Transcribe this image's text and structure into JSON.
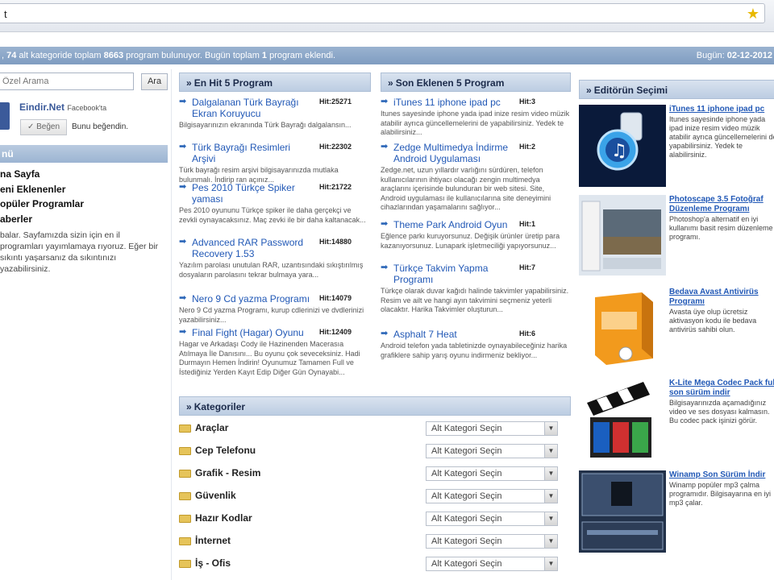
{
  "browser": {
    "url_fragment": "t"
  },
  "infobar": {
    "left_prefix": ", ",
    "cat_count": "74",
    "left_mid": " alt kategoride toplam ",
    "program_count": "8663",
    "left_mid2": " program bulunuyor. Bugün toplam ",
    "today_count": "1",
    "left_suffix": " program eklendi.",
    "right_label": "Bugün: ",
    "date": "02-12-2012"
  },
  "search": {
    "placeholder": "Özel Arama",
    "button": "Ara"
  },
  "facebook": {
    "name": "Eindir.Net",
    "sub": "Facebook'ta",
    "like": "Beğen",
    "like_text": "Bunu beğendin."
  },
  "menu": {
    "header": "nü",
    "items": [
      "na Sayfa",
      "eni Eklenenler",
      "opüler Programlar",
      "aberler"
    ],
    "note": "balar. Sayfamızda sizin için en il programları yayımlamaya rıyoruz. Eğer bir sıkıntı yaşarsanız da sıkıntınızı yazabilirsiniz."
  },
  "hit5": {
    "header": "En Hit 5 Program",
    "items": [
      {
        "title": "Dalgalanan Türk Bayrağı Ekran Koruyucu",
        "hit": "Hit:25271",
        "desc": "Bilgisayarınızın ekranında Türk Bayrağı dalgalansın..."
      },
      {
        "title": "Türk Bayrağı Resimleri Arşivi",
        "hit": "Hit:22302",
        "desc": "Türk bayrağı resim arşivi bilgisayarınızda mutlaka bulunmalı. İndirip ran açınız..."
      },
      {
        "title": "Pes 2010 Türkçe Spiker yaması",
        "hit": "Hit:21722",
        "desc": "Pes 2010 oyununu Türkçe spiker ile daha gerçekçi ve zevkli oynayacaksınız. Maç zevki ile bir daha kaltanacak..."
      },
      {
        "title": "Advanced RAR Password Recovery 1.53",
        "hit": "Hit:14880",
        "desc": "Yazılım parolası unutulan RAR, uzantısındaki sıkıştırılmış dosyaların parolasını tekrar bulmaya yara..."
      },
      {
        "title": "Nero 9 Cd yazma Programı",
        "hit": "Hit:14079",
        "desc": "Nero 9 Cd yazma Programı, kurup cdlerinizi ve dvdlerinizi yazabilirsiniz..."
      },
      {
        "title": "Final Fight (Hagar) Oyunu",
        "hit": "Hit:12409",
        "desc": "Hagar ve Arkadaşı Cody ile Hazinenden Macerasıa Atılmaya İle Danısını... Bu oyunu çok seveceksiniz. Hadi Durmayın Hemen İndirin! Oyunumuz Tamamen Full ve İstediğiniz Yerden Kayıt Edip Diğer Gün Oynayabi..."
      }
    ]
  },
  "son5": {
    "header": "Son Eklenen 5 Program",
    "items": [
      {
        "title": "iTunes 11 iphone ipad pc",
        "hit": "Hit:3",
        "desc": "Itunes sayesinde iphone yada ipad inize resim video müzik atabilir ayrıca güncellemelerini de yapabilirsiniz. Yedek te alabilirsiniz..."
      },
      {
        "title": "Zedge Multimedya İndirme Android Uygulaması",
        "hit": "Hit:2",
        "desc": "Zedge.net, uzun yıllardır varlığını sürdüren, telefon kullanıcılarının ihtiyacı olacağı zengin multimedya araçlarını içerisinde bulunduran bir web sitesi. Site, Android uygulaması ile kullanıcılarına site deneyimini cihazlarından yaşamalarını sağlıyor..."
      },
      {
        "title": "Theme Park Android Oyun",
        "hit": "Hit:1",
        "desc": "Eğlence parkı kuruyorsunuz. Değişik ürünler üretip para kazanıyorsunuz. Lunapark işletmeciliği yapıyorsunuz..."
      },
      {
        "title": "Türkçe Takvim Yapma Programı",
        "hit": "Hit:7",
        "desc": "Türkçe olarak duvar kağıdı halinde takvimler yapabilirsiniz. Resim ve ailt ve hangi ayın takvimini seçmeniz yeterli olacaktır. Harika Takvimler oluşturun..."
      },
      {
        "title": "Asphalt 7 Heat",
        "hit": "Hit:6",
        "desc": "Android telefon yada tabletinizde oynayabileceğiniz harika grafiklere sahip yarış oyunu indirmeniz bekliyor..."
      }
    ]
  },
  "kategoriler": {
    "header": "Kategoriler",
    "select_label": "Alt Kategori Seçin",
    "items": [
      "Araçlar",
      "Cep Telefonu",
      "Grafik - Resim",
      "Güvenlik",
      "Hazır Kodlar",
      "İnternet",
      "İş - Ofis"
    ]
  },
  "editor": {
    "header": "Editörün Seçimi",
    "items": [
      {
        "title": "iTunes 11 iphone ipad pc",
        "desc": "Itunes sayesinde iphone yada ipad inize resim video müzik atabilir ayrıca güncellemelerini de yapabilirsiniz. Yedek te alabilirsiniz."
      },
      {
        "title": "Photoscape 3.5 Fotoğraf Düzenleme Programı",
        "desc": "Photoshop'a alternatif en iyi kullanımı basit resim düzenleme programı."
      },
      {
        "title": "Bedava Avast Antivirüs Programı",
        "desc": "Avasta üye olup ücretsiz aktivasyon kodu ile bedava antivirüs sahibi olun."
      },
      {
        "title": "K-Lite Mega Codec Pack full son sürüm indir",
        "desc": "Bilgisayarınızda açamadığınız video ve ses dosyası kalmasın. Bu codec pack işinizi görür."
      },
      {
        "title": "Winamp Son Sürüm İndir",
        "desc": "Winamp popüler mp3 çalma programıdır. Bilgisayarına en iyi mp3 çalar."
      }
    ]
  },
  "colors": {
    "link": "#2158b6",
    "header_bar": "#8ea8c9",
    "date": "#ffffff"
  }
}
